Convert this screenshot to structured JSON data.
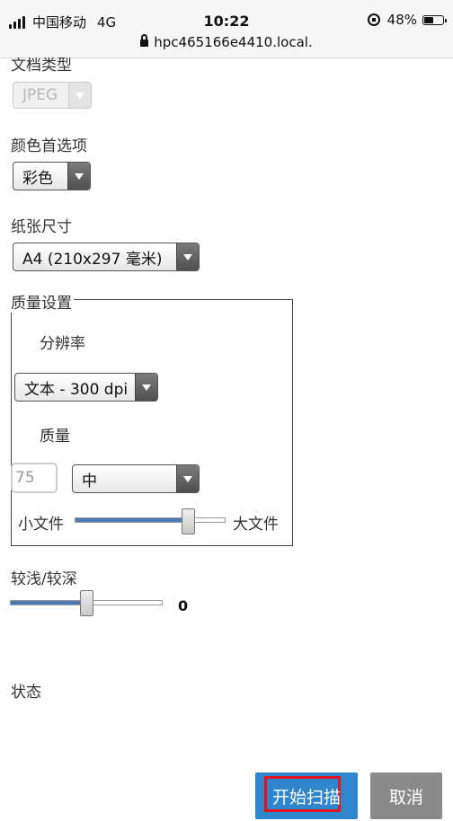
{
  "status_bar": {
    "carrier": "中国移动",
    "network": "4G",
    "time": "10:22",
    "battery_percent": "48%",
    "battery_level": 0.48,
    "url": "hpc465166e4410.local."
  },
  "doc_type": {
    "label": "文档类型",
    "value": "JPEG"
  },
  "color_pref": {
    "label": "颜色首选项",
    "value": "彩色"
  },
  "paper_size": {
    "label": "纸张尺寸",
    "value": "A4 (210x297 毫米)"
  },
  "quality_settings": {
    "legend": "质量设置",
    "resolution_label": "分辨率",
    "resolution_value": "文本 - 300 dpi",
    "quality_label": "质量",
    "quality_number": "75",
    "quality_level": "中",
    "small_file_label": "小文件",
    "large_file_label": "大文件",
    "quality_slider_fraction": 0.75
  },
  "lightness": {
    "label": "较浅/较深",
    "value": "0",
    "slider_fraction": 0.5
  },
  "status": {
    "label": "状态"
  },
  "buttons": {
    "start_scan": "开始扫描",
    "cancel": "取消"
  },
  "colors": {
    "accent": "#2f86cc",
    "slider_fill": "#4a7ab5",
    "highlight_border": "#e0141e",
    "cancel_bg": "#8a8a8a"
  }
}
